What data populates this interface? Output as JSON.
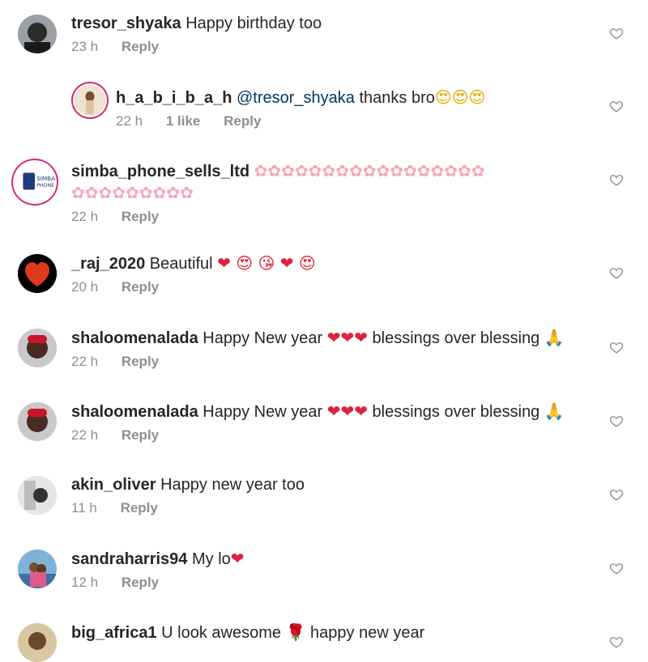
{
  "comments": [
    {
      "user": "tresor_shyaka",
      "text": "Happy birthday too",
      "time": "23 h",
      "likes": "",
      "reply": "Reply",
      "emoji": ""
    },
    {
      "user": "h_a_b_i_b_a_h",
      "mention": "@tresor_shyaka",
      "text": "thanks bro",
      "emoji": "😍😍😍",
      "time": "22 h",
      "likes": "1 like",
      "reply": "Reply"
    },
    {
      "user": "simba_phone_sells_ltd",
      "text": "",
      "emoji_line1": "✿✿✿✿✿✿✿✿✿✿✿✿✿✿✿✿✿",
      "emoji_line2": "✿✿✿✿✿✿✿✿✿",
      "time": "22 h",
      "reply": "Reply"
    },
    {
      "user": "_raj_2020",
      "text": "Beautiful",
      "emoji": "❤ 😍 😘 ❤ 😍",
      "time": "20 h",
      "reply": "Reply"
    },
    {
      "user": "shaloomenalada",
      "text": "Happy New year",
      "emoji": "❤❤❤",
      "text2": "blessings over blessing",
      "emoji2": "🙏",
      "time": "22 h",
      "reply": "Reply"
    },
    {
      "user": "shaloomenalada",
      "text": "Happy New year",
      "emoji": "❤❤❤",
      "text2": "blessings over blessing",
      "emoji2": "🙏",
      "time": "22 h",
      "reply": "Reply"
    },
    {
      "user": "akin_oliver",
      "text": "Happy new year too",
      "time": "11 h",
      "reply": "Reply"
    },
    {
      "user": "sandraharris94",
      "text": "My lo",
      "emoji": "❤",
      "time": "12 h",
      "reply": "Reply"
    },
    {
      "user": "big_africa1",
      "text": "U look awesome",
      "emoji": "🌹",
      "text2": "happy new year"
    }
  ],
  "icons": {
    "like": "heart-outline-icon"
  },
  "colors": {
    "username": "#262626",
    "meta": "#8e8e8e",
    "mention": "#00376b",
    "heart": "#e0213b"
  }
}
